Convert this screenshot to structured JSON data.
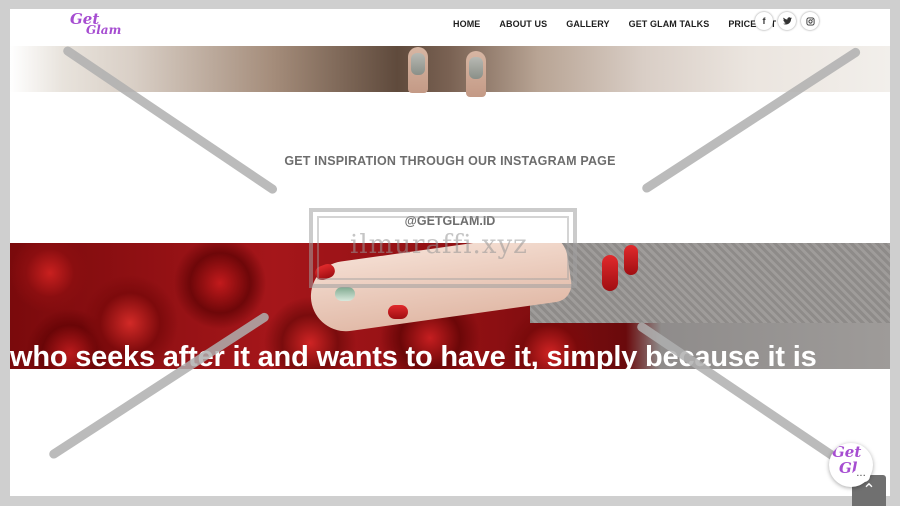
{
  "brand": {
    "logo_line1": "Get",
    "logo_line2": "Glam"
  },
  "nav": {
    "items": [
      "HOME",
      "ABOUT US",
      "GALLERY",
      "GET GLAM TALKS",
      "PRICELIST"
    ]
  },
  "social": {
    "facebook_glyph": "f",
    "twitter_glyph": "🐦",
    "instagram_glyph": "◎",
    "icons": [
      "facebook-icon",
      "twitter-icon",
      "instagram-icon"
    ]
  },
  "instagram_section": {
    "title": "GET INSPIRATION THROUGH OUR INSTAGRAM PAGE",
    "handle": "@GETGLAM.ID"
  },
  "watermark": {
    "text": "ilmuraffi.xyz"
  },
  "banner": {
    "quote": "who seeks after it and wants to have it, simply because it is"
  },
  "chat": {
    "logo_line1": "Get",
    "logo_line2": "Gl",
    "dots": "..."
  },
  "scroll_top": {
    "glyph": "⌃"
  },
  "colors": {
    "brand_purple": "#a64dd1",
    "nav_text": "#1e1e1e",
    "section_text": "#6d6d6d"
  }
}
